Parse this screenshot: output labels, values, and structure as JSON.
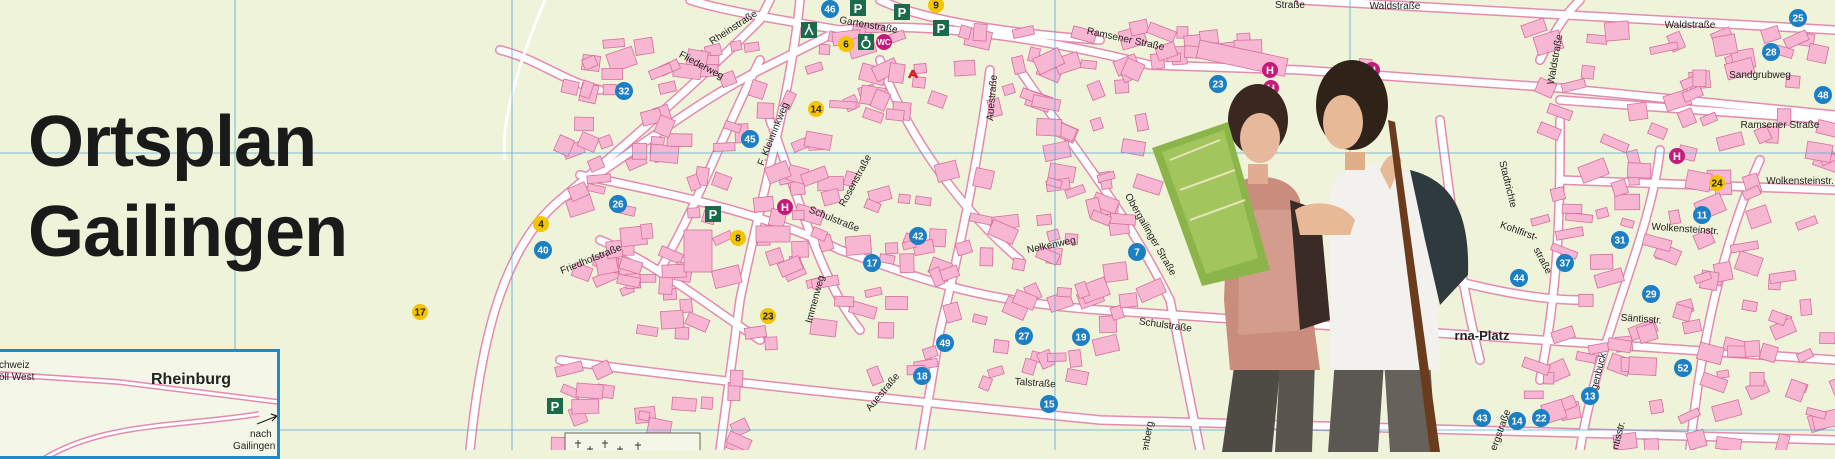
{
  "title": {
    "line1": "Ortsplan",
    "line2": "Gailingen"
  },
  "inset": {
    "labels": [
      "chweiz",
      "öll West",
      "Rheinburg",
      "nach",
      "Gailingen"
    ]
  },
  "streets": [
    "Rheinstraße",
    "Fliederweg",
    "Gartenstraße",
    "Ramsener Straße",
    "Waldstraße",
    "Waldstraße",
    "Sandgrubweg",
    "Ramsener Straße",
    "F. Kleinrinkweg",
    "Rosenstraße",
    "Schulstraße",
    "Auestraße",
    "Friedhofstraße",
    "Immenweg",
    "Nelkenweg",
    "Obergailinger Straße",
    "Schulstraße",
    "Talstraße",
    "Auestraße",
    "Stadtrichte",
    "Kohlfirst-",
    "straße",
    "Sagenbuck",
    "Säntisstr.",
    "Säntisstr.",
    "Wolkensteinstr.",
    "Wolkensteinstr.",
    "Waldstraße",
    "denberg",
    "rna-Platz",
    "lenbergstraße",
    "Straße"
  ],
  "markers": {
    "blue": [
      "46",
      "32",
      "45",
      "26",
      "40",
      "42",
      "17",
      "49",
      "18",
      "27",
      "19",
      "15",
      "7",
      "23",
      "25",
      "28",
      "48",
      "11",
      "31",
      "37",
      "44",
      "29",
      "52",
      "13",
      "43",
      "14",
      "22"
    ],
    "yellow": [
      "9",
      "6",
      "14",
      "4",
      "8",
      "23",
      "17",
      "24"
    ],
    "parking": [
      "P",
      "P",
      "P",
      "P",
      "P"
    ],
    "bus": [
      "H",
      "H",
      "H",
      "H",
      "H"
    ],
    "wc": "WC"
  },
  "colors": {
    "background": "#eef3d9",
    "building": "#f7b6d2",
    "building_stroke": "#d6709f",
    "road": "#ffffff",
    "road_edge": "#e58ab0",
    "grid": "#58a8dd",
    "blue_marker": "#1c7fc4",
    "yellow_marker": "#f4c400",
    "bus_marker": "#c51a7a",
    "parking": "#1b6b4a"
  }
}
